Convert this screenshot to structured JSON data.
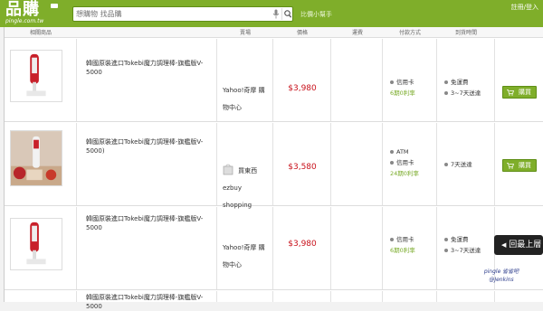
{
  "header": {
    "logo_text": "品購",
    "logo_sub": "pingle.com.tw",
    "search_placeholder": "想購物 找品購",
    "helper_link": "比價小幫手",
    "login_link": "註冊/登入"
  },
  "table": {
    "headers": [
      "相關商品",
      "賣場",
      "價格",
      "運費",
      "付款方式",
      "到貨時間"
    ],
    "rows": [
      {
        "name": "韓國原裝進口Tokebi魔力調理棒-旗艦版V-5000",
        "store": "Yahoo!奇摩 購物中心",
        "price": "$3,980",
        "pay": [
          "信用卡"
        ],
        "pay_sub": "6期0利率",
        "arrive": [
          "免運費",
          "3~7天送達"
        ],
        "buy_label": "購買"
      },
      {
        "name": "韓國原裝進口Tokebi魔力調理棒-旗艦版V-5000)",
        "store": "買東西 ezbuy shopping",
        "price": "$3,580",
        "pay": [
          "ATM",
          "信用卡"
        ],
        "pay_sub": "24期0利率",
        "arrive": [
          "7天送達"
        ],
        "buy_label": "購買"
      },
      {
        "name": "韓國原裝進口Tokebi魔力調理棒-旗艦版V-5000",
        "store": "Yahoo!奇摩 購物中心",
        "price": "$3,980",
        "pay": [
          "信用卡"
        ],
        "pay_sub": "6期0利率",
        "arrive": [
          "免運費",
          "3~7天送達"
        ],
        "buy_label": "購買"
      },
      {
        "name": "韓國原裝進口Tokebi魔力調理棒-旗艦版V-5000",
        "store": "",
        "price": "",
        "pay": [],
        "pay_sub": "",
        "arrive": [],
        "buy_label": ""
      }
    ]
  },
  "back_to_top": "回最上層",
  "watermark": "pingle 省省吧 @Jenkins",
  "colors": {
    "topbar": "#7fae2a",
    "price": "#c8101a",
    "accent": "#7aab2a"
  }
}
